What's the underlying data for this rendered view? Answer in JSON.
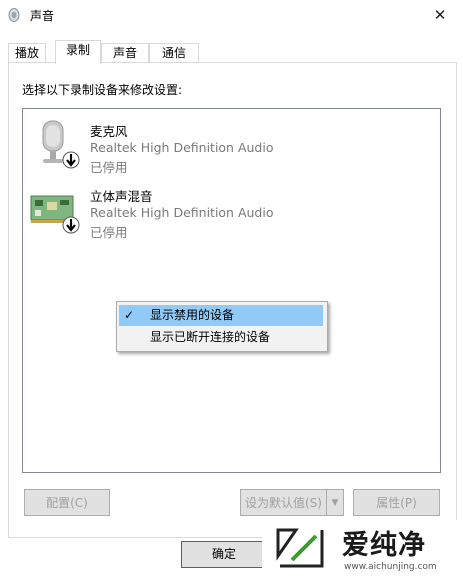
{
  "window": {
    "title": "声音",
    "close_icon": "close-icon"
  },
  "tabs": [
    {
      "label": "播放",
      "active": false
    },
    {
      "label": "录制",
      "active": true
    },
    {
      "label": "声音",
      "active": false
    },
    {
      "label": "通信",
      "active": false
    }
  ],
  "instruction": "选择以下录制设备来修改设置:",
  "devices": [
    {
      "name": "麦克风",
      "driver": "Realtek High Definition Audio",
      "status": "已停用",
      "icon": "microphone-icon"
    },
    {
      "name": "立体声混音",
      "driver": "Realtek High Definition Audio",
      "status": "已停用",
      "icon": "sound-card-icon"
    }
  ],
  "context_menu": {
    "items": [
      {
        "label": "显示禁用的设备",
        "checked": true,
        "highlighted": true
      },
      {
        "label": "显示已断开连接的设备",
        "checked": false,
        "highlighted": false
      }
    ],
    "check_mark": "✓"
  },
  "buttons": {
    "configure": "配置(C)",
    "set_default": "设为默认值(S)",
    "properties": "属性(P)",
    "ok": "确定"
  },
  "watermark": {
    "title": "爱纯净",
    "url": "www.aichunjing.com"
  },
  "colors": {
    "highlight": "#91c9f7",
    "disabled_text": "#7a7a7a",
    "ok_border": "#0078d7"
  }
}
